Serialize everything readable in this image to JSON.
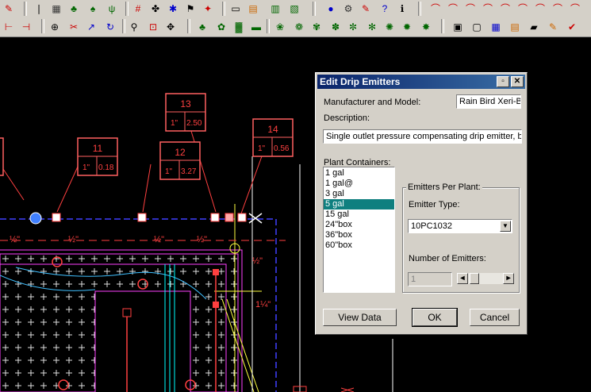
{
  "dialog": {
    "title": "Edit Drip Emitters",
    "manufacturer_label": "Manufacturer and Model:",
    "manufacturer_value": "Rain Bird Xeri-B",
    "description_label": "Description:",
    "description_value": "Single outlet pressure compensating drip emitter, bar",
    "containers_label": "Plant Containers:",
    "containers": [
      "1 gal",
      "1 gal@",
      "3 gal",
      "5 gal",
      "15 gal",
      "24\"box",
      "36\"box",
      "60\"box"
    ],
    "selected_container": "5 gal",
    "emitters_group_label": "Emitters Per Plant:",
    "emitter_type_label": "Emitter Type:",
    "emitter_type_value": "10PC1032",
    "num_emitters_label": "Number of Emitters:",
    "num_emitters_value": "1",
    "view_data_label": "View Data",
    "ok_label": "OK",
    "cancel_label": "Cancel"
  },
  "drawing": {
    "callouts": [
      {
        "num": "11",
        "size": "1\"",
        "val": "0.18"
      },
      {
        "num": "12",
        "size": "1\"",
        "val": "3.27"
      },
      {
        "num": "13",
        "size": "1\"",
        "val": "2.50"
      },
      {
        "num": "14",
        "size": "1\"",
        "val": "0.56"
      }
    ],
    "pipe_labels": [
      "½\"",
      "½\"",
      "½\"",
      "½\"",
      "½\"",
      "1¼\""
    ],
    "colors": {
      "red": "#ff4040",
      "blue": "#4040ff",
      "magenta": "#ff40ff",
      "yellow": "#ffff40",
      "cyan": "#40c0ff"
    }
  }
}
